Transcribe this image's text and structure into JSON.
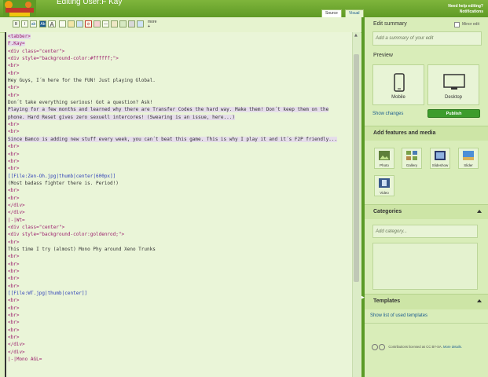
{
  "header": {
    "title": "Editing User:F Kay",
    "help_line1": "Need help editing?",
    "help_line2": "Notifications",
    "tabs": [
      "Source",
      "Visual"
    ],
    "colors": {
      "bar": "#6aa82e"
    }
  },
  "toolbar": {
    "buttons": [
      "B",
      "I",
      "ab",
      "Ab",
      "A",
      "more"
    ],
    "more_label": "more",
    "more_plus": "+"
  },
  "editor": {
    "lines": [
      {
        "t": "<tabber>",
        "c": "hl"
      },
      {
        "t": "F.Kay=",
        "c": "hl"
      },
      {
        "t": "<div class=\"center\">",
        "c": ""
      },
      {
        "t": "<div style=\"background-color:#ffffff;\">",
        "c": ""
      },
      {
        "t": "<br>",
        "c": ""
      },
      {
        "t": "<br>",
        "c": ""
      },
      {
        "t": "Hey Guys, I´m here for the FUN! Just playing Global.",
        "c": "p"
      },
      {
        "t": "<br>",
        "c": ""
      },
      {
        "t": "<br>",
        "c": ""
      },
      {
        "t": "Don´t take everything serious! Got a question? Ask!",
        "c": "p"
      },
      {
        "t": "Playing for a few months and learned why there are Transfer Codes the hard way. Make them! Don´t keep them on the",
        "c": "p hl"
      },
      {
        "t": "phone. Hard Reset gives zero sexuell intercores! (Swearing is an issue, here...)",
        "c": "p hl"
      },
      {
        "t": "<br>",
        "c": ""
      },
      {
        "t": "<br>",
        "c": ""
      },
      {
        "t": "Since Bamco is adding new stuff every week, you can´t beat this game. This is why I play it and it´s F2P friendly...",
        "c": "p hl"
      },
      {
        "t": "<br>",
        "c": ""
      },
      {
        "t": "<br>",
        "c": ""
      },
      {
        "t": "<br>",
        "c": ""
      },
      {
        "t": "<br>",
        "c": ""
      },
      {
        "t": "[[File:Zen-Oh.jpg|thumb|center|600px]]",
        "c": "lnk"
      },
      {
        "t": "(Most badass fighter there is. Period!)",
        "c": "p"
      },
      {
        "t": "<br>",
        "c": ""
      },
      {
        "t": "<br>",
        "c": ""
      },
      {
        "t": "</div>",
        "c": ""
      },
      {
        "t": "</div>",
        "c": ""
      },
      {
        "t": "|-|Wt=",
        "c": ""
      },
      {
        "t": "<div class=\"center\">",
        "c": ""
      },
      {
        "t": "<div style=\"background-color:goldenrod;\">",
        "c": ""
      },
      {
        "t": "<br>",
        "c": ""
      },
      {
        "t": "This time I try (almost) Mono Phy around Xeno Trunks",
        "c": "p"
      },
      {
        "t": "<br>",
        "c": ""
      },
      {
        "t": "<br>",
        "c": ""
      },
      {
        "t": "<br>",
        "c": ""
      },
      {
        "t": "<br>",
        "c": ""
      },
      {
        "t": "<br>",
        "c": ""
      },
      {
        "t": "[[File:WT.jpg|thumb|center]]",
        "c": "lnk"
      },
      {
        "t": "<br>",
        "c": ""
      },
      {
        "t": "<br>",
        "c": ""
      },
      {
        "t": "<br>",
        "c": ""
      },
      {
        "t": "<br>",
        "c": ""
      },
      {
        "t": "<br>",
        "c": ""
      },
      {
        "t": "<br>",
        "c": ""
      },
      {
        "t": "</div>",
        "c": ""
      },
      {
        "t": "</div>",
        "c": ""
      },
      {
        "t": "|-|Mono AGL=",
        "c": ""
      }
    ]
  },
  "sidebar": {
    "summary_label": "Edit summary",
    "minor_label": "Minor edit",
    "summary_placeholder": "Add a summary of your edit",
    "preview_label": "Preview",
    "mobile_label": "Mobile",
    "desktop_label": "Desktop",
    "show_changes": "Show changes",
    "publish": "Publish",
    "features_label": "Add features and media",
    "features": [
      "Photo",
      "Gallery",
      "Slideshow",
      "Slider",
      "Video"
    ],
    "categories_label": "Categories",
    "category_placeholder": "Add category...",
    "templates_label": "Templates",
    "templates_link": "Show list of used templates",
    "license": "Contributions licensed as CC BY-SA.",
    "license_more": "More details."
  }
}
